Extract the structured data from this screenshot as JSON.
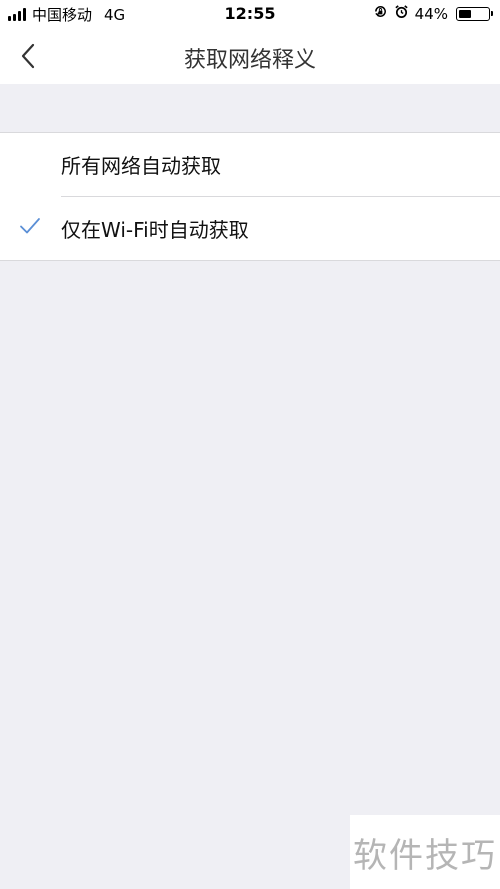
{
  "status_bar": {
    "carrier": "中国移动",
    "network": "4G",
    "time": "12:55",
    "battery_percent": "44%",
    "battery_level": 0.44,
    "icons": [
      "signal-icon",
      "orientation-lock-icon",
      "alarm-icon",
      "battery-icon"
    ]
  },
  "nav": {
    "title": "获取网络释义",
    "back_icon": "chevron-left-icon"
  },
  "options": [
    {
      "label": "所有网络自动获取",
      "selected": false
    },
    {
      "label": "仅在Wi-Fi时自动获取",
      "selected": true
    }
  ],
  "colors": {
    "background": "#efeff4",
    "check": "#5b8fd6",
    "watermark": "#b5b5b5"
  },
  "watermark": {
    "text": "软件技巧"
  }
}
